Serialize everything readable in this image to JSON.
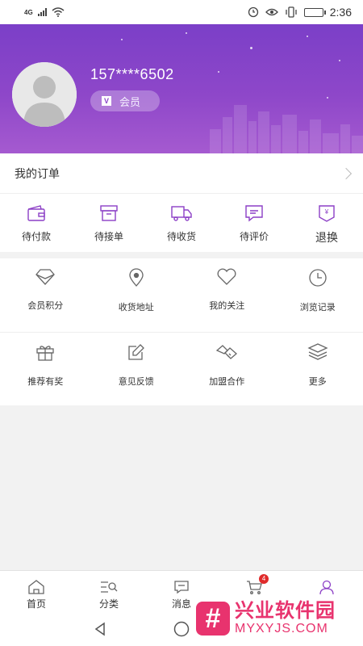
{
  "status": {
    "time": "2:36",
    "network": "4G"
  },
  "profile": {
    "phone": "157****6502",
    "member_label": "会员"
  },
  "orders": {
    "title": "我的订单",
    "items": [
      {
        "label": "待付款",
        "icon": "wallet-icon"
      },
      {
        "label": "待接单",
        "icon": "box-icon"
      },
      {
        "label": "待收货",
        "icon": "truck-icon"
      },
      {
        "label": "待评价",
        "icon": "comment-icon"
      },
      {
        "label": "退换",
        "icon": "refund-icon"
      }
    ]
  },
  "services": [
    {
      "label": "会员积分",
      "icon": "diamond-icon"
    },
    {
      "label": "收货地址",
      "icon": "location-pin-icon"
    },
    {
      "label": "我的关注",
      "icon": "heart-icon"
    },
    {
      "label": "浏览记录",
      "icon": "clock-icon"
    },
    {
      "label": "推荐有奖",
      "icon": "gift-icon"
    },
    {
      "label": "意见反馈",
      "icon": "edit-icon"
    },
    {
      "label": "加盟合作",
      "icon": "handshake-icon"
    },
    {
      "label": "更多",
      "icon": "layers-icon"
    }
  ],
  "tabbar": {
    "tabs": [
      {
        "label": "首页",
        "icon": "home-icon"
      },
      {
        "label": "分类",
        "icon": "category-search-icon"
      },
      {
        "label": "消息",
        "icon": "message-icon"
      },
      {
        "label": "",
        "icon": "cart-icon",
        "badge": "4"
      },
      {
        "label": "",
        "icon": "profile-icon"
      }
    ]
  },
  "watermark": {
    "logo_char": "#",
    "cn": "兴业软件园",
    "en": "MYXYJS.COM"
  },
  "colors": {
    "accent": "#8c3fc6",
    "header_top": "#7b3fc8",
    "header_bottom": "#a55ad0",
    "badge": "#e02a2a",
    "watermark": "#e8336e"
  }
}
